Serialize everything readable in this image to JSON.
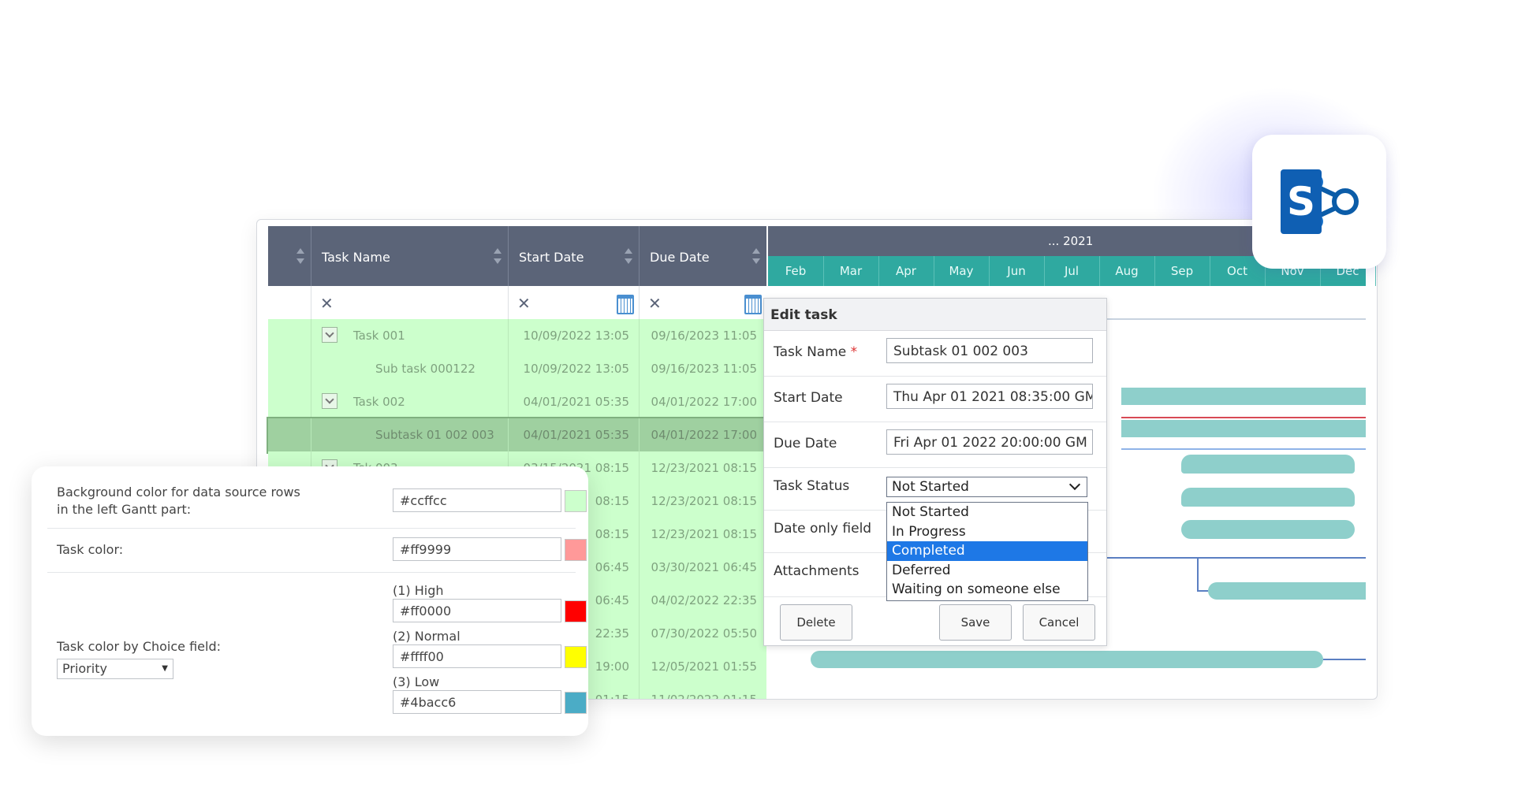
{
  "grid": {
    "headers": {
      "task_name": "Task Name",
      "start_date": "Start Date",
      "due_date": "Due Date"
    },
    "rows": [
      {
        "name": "Task 001",
        "start": "10/09/2022 13:05",
        "due": "09/16/2023 11:05"
      },
      {
        "name": "Sub task 000122",
        "start": "10/09/2022 13:05",
        "due": "09/16/2023 11:05"
      },
      {
        "name": "Task 002",
        "start": "04/01/2021 05:35",
        "due": "04/01/2022 17:00"
      },
      {
        "name": "Subtask 01 002 003",
        "start": "04/01/2021 05:35",
        "due": "04/01/2022 17:00"
      },
      {
        "name": "Tsk 003",
        "start": "03/15/2021 08:15",
        "due": "12/23/2021 08:15"
      },
      {
        "name": "",
        "start": "08:15",
        "due": "12/23/2021 08:15"
      },
      {
        "name": "",
        "start": "08:15",
        "due": "12/23/2021 08:15"
      },
      {
        "name": "",
        "start": "06:45",
        "due": "03/30/2021 06:45"
      },
      {
        "name": "",
        "start": "06:45",
        "due": "04/02/2022 22:35"
      },
      {
        "name": "",
        "start": "22:35",
        "due": "07/30/2022 05:50"
      },
      {
        "name": "",
        "start": "19:00",
        "due": "12/05/2021 01:55"
      },
      {
        "name": "",
        "start": "01:15",
        "due": "11/02/2022 01:15"
      }
    ]
  },
  "timeline": {
    "year": "... 2021",
    "months": [
      "Feb",
      "Mar",
      "Apr",
      "May",
      "Jun",
      "Jul",
      "Aug",
      "Sep",
      "Oct",
      "Nov",
      "Dec"
    ]
  },
  "edit_task": {
    "title": "Edit task",
    "task_name_label": "Task Name",
    "required_mark": "*",
    "task_name_value": "Subtask 01 002 003",
    "start_date_label": "Start Date",
    "start_date_value": "Thu Apr 01 2021 08:35:00 GM",
    "due_date_label": "Due Date",
    "due_date_value": "Fri Apr 01 2022 20:00:00 GM",
    "task_status_label": "Task Status",
    "task_status_value": "Not Started",
    "status_options": [
      "Not Started",
      "In Progress",
      "Completed",
      "Deferred",
      "Waiting on someone else"
    ],
    "date_only_label": "Date only field",
    "attachments_label": "Attachments",
    "delete": "Delete",
    "save": "Save",
    "cancel": "Cancel"
  },
  "settings": {
    "bg_label_line1": "Background color for data source rows",
    "bg_label_line2": "in the left Gantt part:",
    "bg_value": "#ccffcc",
    "bg_color": "#ccffcc",
    "task_color_label": "Task color:",
    "task_color_value": "#ff9999",
    "task_color": "#ff9999",
    "choice_label": "Task color by Choice field:",
    "choice_field": "Priority",
    "high_label": "(1) High",
    "high_value": "#ff0000",
    "normal_label": "(2) Normal",
    "normal_value": "#ffff00",
    "low_label": "(3) Low",
    "low_value": "#4bacc6"
  },
  "colors": {
    "header": "#5b6478",
    "timeline_months": "#2fa9a0",
    "row_green": "#ccffcc",
    "bar": "#8ecfcb",
    "sharepoint_blue": "#036c70"
  }
}
